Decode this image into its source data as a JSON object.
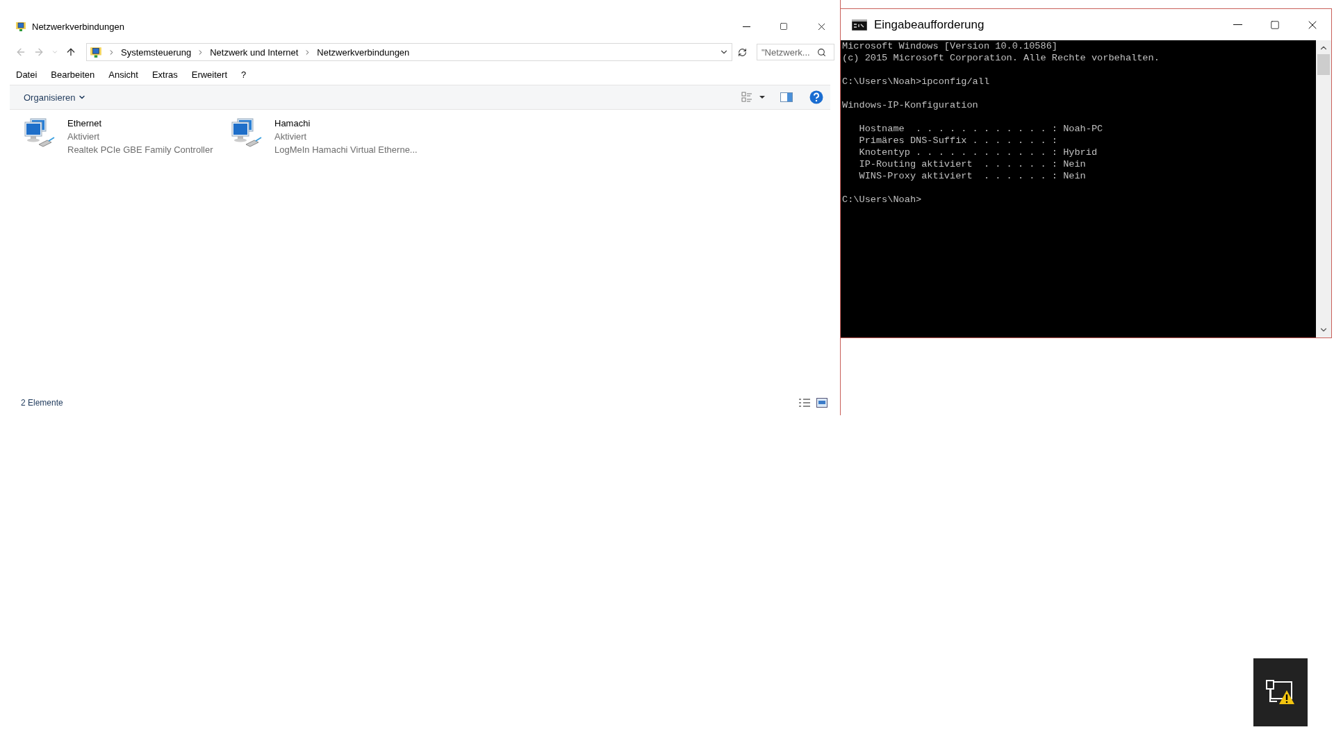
{
  "explorer": {
    "title": "Netzwerkverbindungen",
    "breadcrumb": [
      "Systemsteuerung",
      "Netzwerk und Internet",
      "Netzwerkverbindungen"
    ],
    "search": {
      "placeholder": "\"Netzwerk..."
    },
    "menu": [
      "Datei",
      "Bearbeiten",
      "Ansicht",
      "Extras",
      "Erweitert",
      "?"
    ],
    "organize": "Organisieren",
    "items": [
      {
        "name": "Ethernet",
        "status": "Aktiviert",
        "device": "Realtek PCIe GBE Family Controller"
      },
      {
        "name": "Hamachi",
        "status": "Aktiviert",
        "device": "LogMeIn Hamachi Virtual Etherne..."
      }
    ],
    "status_bar": "2 Elemente"
  },
  "console": {
    "title": "Eingabeaufforderung",
    "blocks": [
      [
        "Microsoft Windows [Version 10.0.10586]",
        "(c) 2015 Microsoft Corporation. Alle Rechte vorbehalten."
      ],
      [
        "C:\\Users\\Noah>ipconfig/all"
      ],
      [
        "Windows-IP-Konfiguration"
      ],
      [
        "   Hostname  . . . . . . . . . . . . : Noah-PC",
        "   Primäres DNS-Suffix . . . . . . . :",
        "   Knotentyp . . . . . . . . . . . . : Hybrid",
        "   IP-Routing aktiviert  . . . . . . : Nein",
        "   WINS-Proxy aktiviert  . . . . . . : Nein"
      ],
      [
        "C:\\Users\\Noah>"
      ]
    ]
  }
}
